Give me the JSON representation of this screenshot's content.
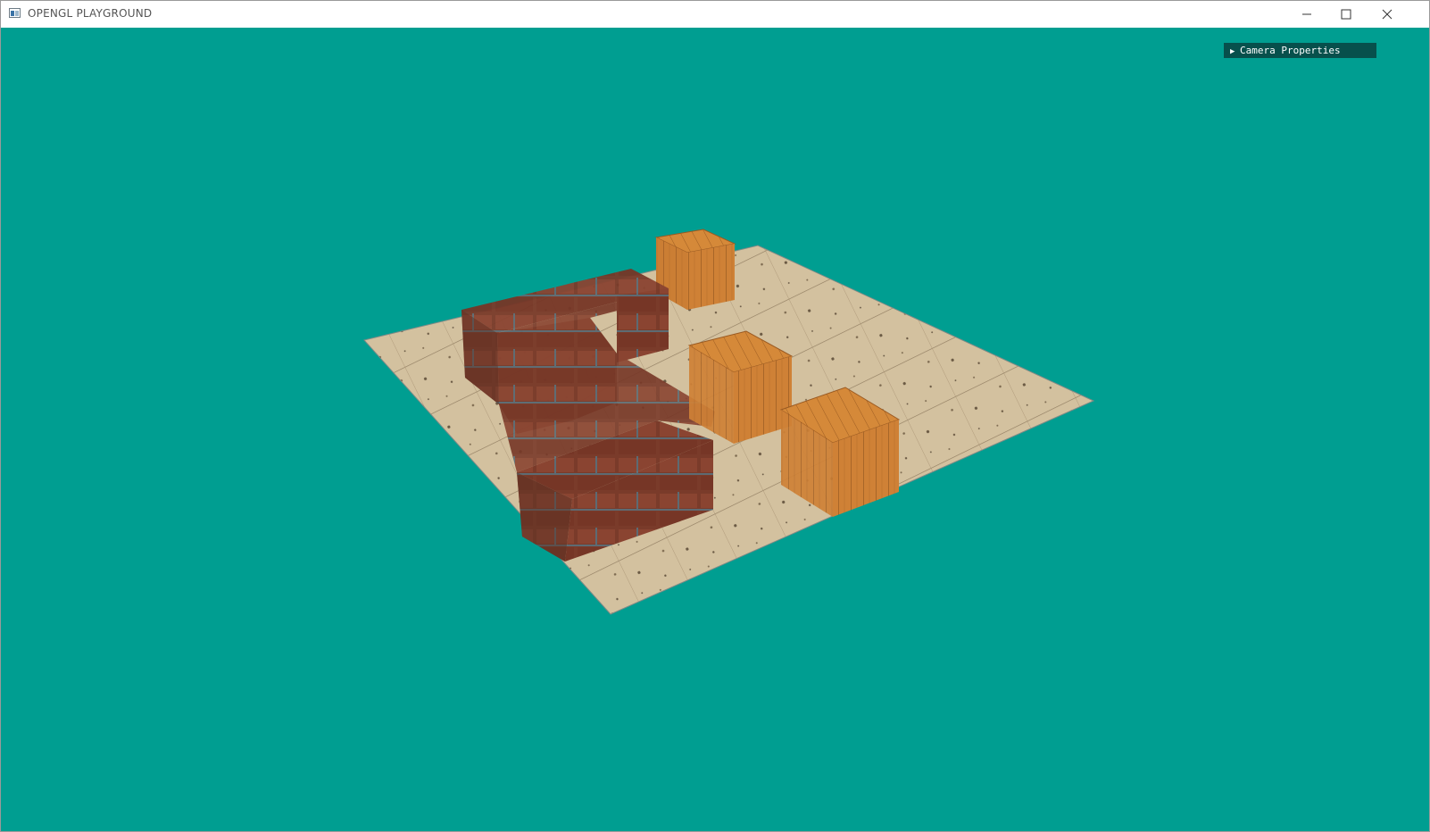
{
  "window": {
    "title": "OPENGL PLAYGROUND",
    "icon": "app-window-icon",
    "controls": [
      "minimize-icon",
      "maximize-icon",
      "close-icon"
    ]
  },
  "viewport": {
    "background_color": "#009e91",
    "camera_panel": {
      "toggle_icon": "triangle-right-icon",
      "label": "Camera Properties",
      "state": "collapsed"
    }
  },
  "colors": {
    "titlebar": "#ffffff",
    "panel_header": "#07504c",
    "floor": "#d2bf9c",
    "brick": "#7d3f2c",
    "crate": "#cf8236"
  }
}
